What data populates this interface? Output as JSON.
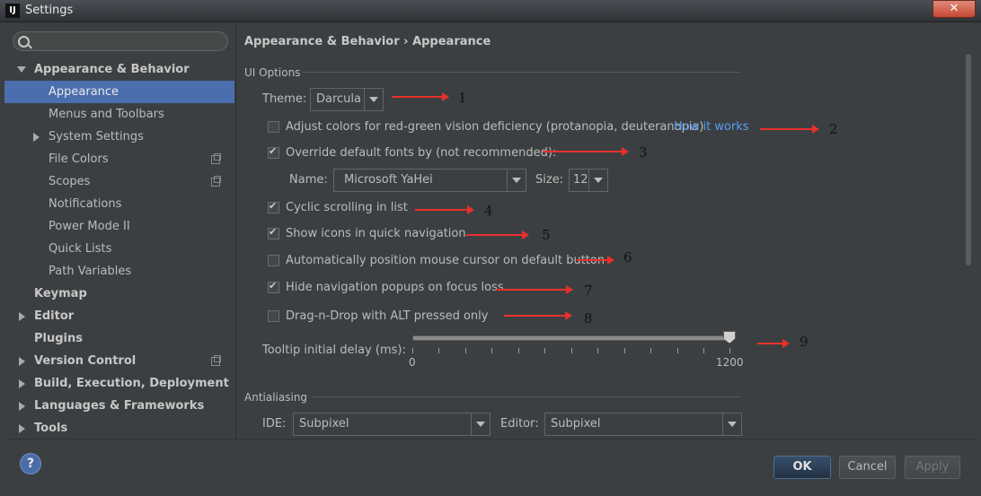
{
  "window": {
    "title": "Settings",
    "app_logo": "IJ",
    "close_glyph": "✕"
  },
  "search": {
    "value": "",
    "placeholder": ""
  },
  "sidebar": {
    "items": [
      {
        "label": "Appearance & Behavior"
      },
      {
        "label": "Appearance"
      },
      {
        "label": "Menus and Toolbars"
      },
      {
        "label": "System Settings"
      },
      {
        "label": "File Colors"
      },
      {
        "label": "Scopes"
      },
      {
        "label": "Notifications"
      },
      {
        "label": "Power Mode II"
      },
      {
        "label": "Quick Lists"
      },
      {
        "label": "Path Variables"
      },
      {
        "label": "Keymap"
      },
      {
        "label": "Editor"
      },
      {
        "label": "Plugins"
      },
      {
        "label": "Version Control"
      },
      {
        "label": "Build, Execution, Deployment"
      },
      {
        "label": "Languages & Frameworks"
      },
      {
        "label": "Tools"
      }
    ]
  },
  "breadcrumb": {
    "parent": "Appearance & Behavior",
    "separator": "›",
    "current": "Appearance"
  },
  "ui_options": {
    "section_title": "UI Options",
    "theme_label": "Theme:",
    "theme_value": "Darcula",
    "adjust_colors": {
      "label": "Adjust colors for red-green vision deficiency (protanopia, deuteranopia)",
      "checked": false
    },
    "how_it_works": "How it works",
    "override_fonts": {
      "label": "Override default fonts by (not recommended):",
      "checked": true
    },
    "font_name_label": "Name:",
    "font_name_value": "Microsoft YaHei",
    "font_size_label": "Size:",
    "font_size_value": "12",
    "cyclic_scrolling": {
      "label": "Cyclic scrolling in list",
      "checked": true
    },
    "show_icons": {
      "label": "Show icons in quick navigation",
      "checked": true
    },
    "auto_position": {
      "label": "Automatically position mouse cursor on default button",
      "checked": false
    },
    "hide_popups": {
      "label": "Hide navigation popups on focus loss",
      "checked": true
    },
    "drag_n_drop": {
      "label": "Drag-n-Drop with ALT pressed only",
      "checked": false
    },
    "tooltip_label": "Tooltip initial delay (ms):",
    "tooltip_min": "0",
    "tooltip_max": "1200",
    "tooltip_value_fraction": 1.0
  },
  "antialiasing": {
    "section_title": "Antialiasing",
    "ide_label": "IDE:",
    "ide_value": "Subpixel",
    "editor_label": "Editor:",
    "editor_value": "Subpixel"
  },
  "annotations": [
    "1",
    "2",
    "3",
    "4",
    "5",
    "6",
    "7",
    "8",
    "9"
  ],
  "footer": {
    "help": "?",
    "ok": "OK",
    "cancel": "Cancel",
    "apply": "Apply"
  },
  "colors": {
    "background": "#3c3f41",
    "selection": "#4b6eaf",
    "link": "#589df6",
    "annotation_arrow": "#e8302c"
  }
}
